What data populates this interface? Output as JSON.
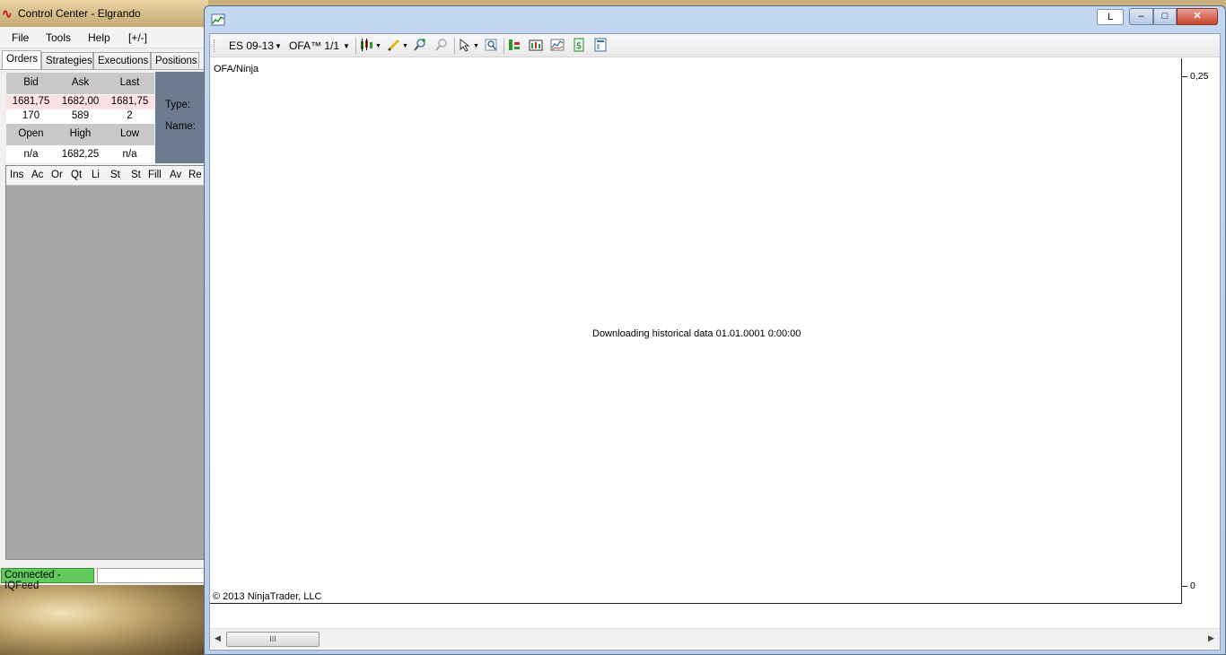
{
  "control_center": {
    "title": "Control Center - Elgrando",
    "menu": [
      "File",
      "Tools",
      "Help",
      "[+/-]"
    ],
    "tabs": [
      "Orders",
      "Strategies",
      "Executions",
      "Positions"
    ],
    "quote": {
      "headers1": [
        "Bid",
        "Ask",
        "Last"
      ],
      "prices": [
        "1681,75",
        "1682,00",
        "1681,75"
      ],
      "sizes": [
        "170",
        "589",
        "2"
      ],
      "headers2": [
        "Open",
        "High",
        "Low"
      ],
      "ohl": [
        "n/a",
        "1682,25",
        "n/a"
      ]
    },
    "order_fields": [
      "Type:",
      "Name:"
    ],
    "grid_columns": [
      "Ins",
      "Ac",
      "Or",
      "Qt",
      "Li",
      "St",
      "St",
      "Fill",
      "Av",
      "Re"
    ],
    "status": "Connected - IQFeed"
  },
  "chart_window": {
    "title_button": "L",
    "window_buttons": [
      "–",
      "□",
      "✕"
    ],
    "toolbar": {
      "instrument": "ES 09-13",
      "period": "OFA™ 1/1"
    },
    "plot": {
      "label": "OFA/Ninja",
      "message": "Downloading historical data 01.01.0001 0:00:00",
      "copyright": "© 2013 NinjaTrader, LLC"
    },
    "y_axis": [
      "0,25",
      "0"
    ],
    "scroll_thumb": "III"
  }
}
